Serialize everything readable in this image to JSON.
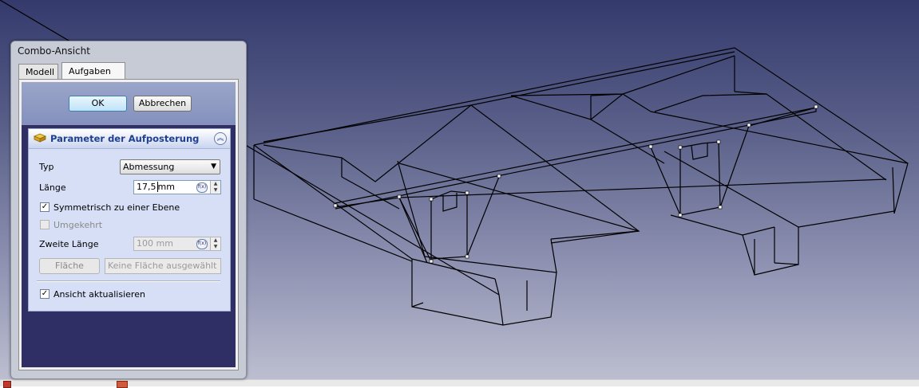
{
  "combo": {
    "title": "Combo-Ansicht",
    "tabs": [
      {
        "label": "Modell",
        "active": false
      },
      {
        "label": "Aufgaben",
        "active": true
      }
    ]
  },
  "dialog": {
    "ok_label": "OK",
    "cancel_label": "Abbrechen"
  },
  "params": {
    "title": "Parameter der Aufposterung",
    "typ_label": "Typ",
    "typ_value": "Abmessung",
    "laenge_label": "Länge",
    "laenge_value": "17,5",
    "laenge_unit": "mm",
    "symmetric_label": "Symmetrisch zu einer Ebene",
    "symmetric_checked": true,
    "reversed_label": "Umgekehrt",
    "reversed_checked": false,
    "second_length_label": "Zweite Länge",
    "second_length_value": "100 mm",
    "face_button_label": "Fläche",
    "face_placeholder": "Keine Fläche ausgewählt",
    "update_view_label": "Ansicht aktualisieren",
    "update_view_checked": true,
    "fx_label": "f(x)"
  },
  "colors": {
    "viewport_top": "#343a6c",
    "viewport_bottom": "#bcbed0",
    "panel_header_text": "#1f3f8f"
  },
  "icons": {
    "param_icon": "pad-feature-icon",
    "collapse_icon": "collapse-up-icon"
  }
}
